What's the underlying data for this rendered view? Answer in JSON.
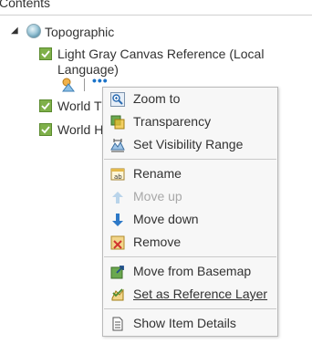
{
  "panel": {
    "title": "Contents"
  },
  "tree": {
    "basemap": {
      "label": "Topographic"
    },
    "layers": [
      {
        "label_line1": "Light Gray Canvas Reference (Local",
        "label_line2": "Language)"
      },
      {
        "label": "World T"
      },
      {
        "label": "World H"
      }
    ],
    "more_button": "•••"
  },
  "menu": {
    "items": [
      {
        "label": "Zoom to",
        "icon": "zoom-to-icon",
        "enabled": true
      },
      {
        "label": "Transparency",
        "icon": "transparency-icon",
        "enabled": true
      },
      {
        "label": "Set Visibility Range",
        "icon": "visibility-range-icon",
        "enabled": true
      },
      {
        "label": "Rename",
        "icon": "rename-icon",
        "enabled": true
      },
      {
        "label": "Move up",
        "icon": "arrow-up-icon",
        "enabled": false
      },
      {
        "label": "Move down",
        "icon": "arrow-down-icon",
        "enabled": true
      },
      {
        "label": "Remove",
        "icon": "remove-icon",
        "enabled": true
      },
      {
        "label": "Move from Basemap",
        "icon": "move-from-basemap-icon",
        "enabled": true
      },
      {
        "label": "Set as Reference Layer",
        "icon": "reference-layer-icon",
        "enabled": true,
        "hovered": true
      },
      {
        "label": "Show Item Details",
        "icon": "item-details-icon",
        "enabled": true
      }
    ]
  },
  "colors": {
    "accent_blue": "#1a73c9",
    "layer_green": "#7fb04a",
    "menu_bg": "#f7f7f7",
    "disabled_text": "#a8a8a8"
  }
}
